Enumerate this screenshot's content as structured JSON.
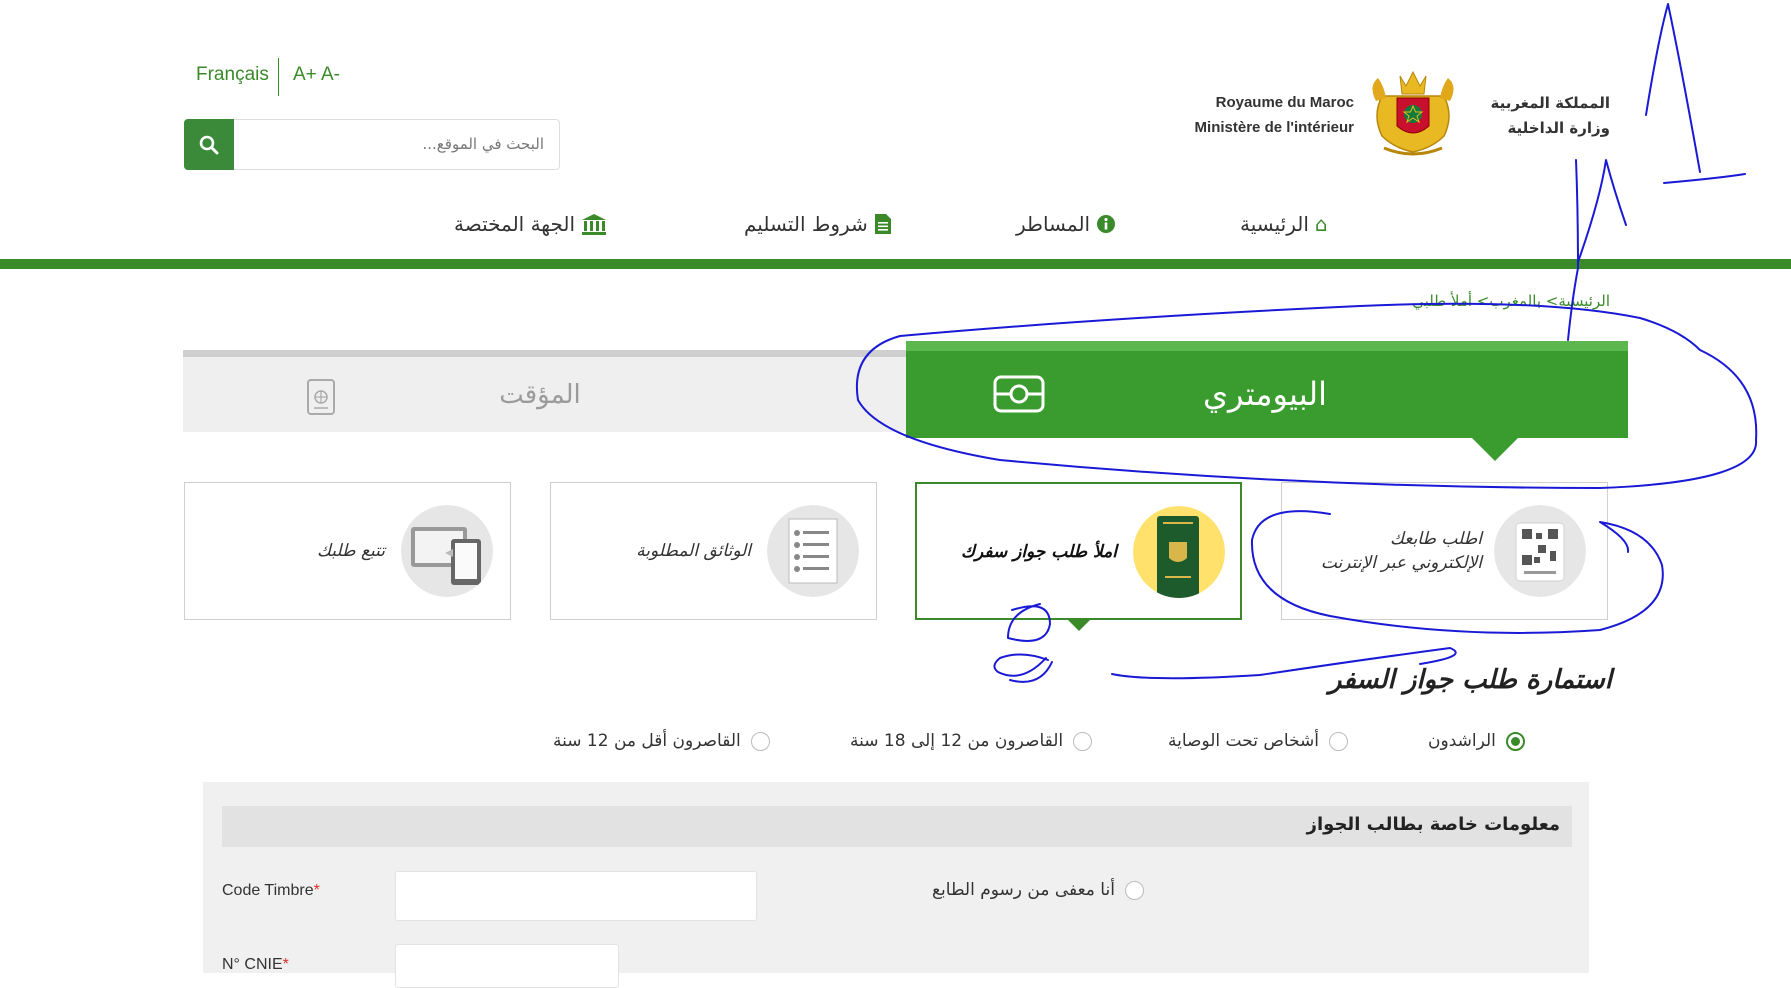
{
  "header": {
    "language_link": "Français",
    "font_size_controls": "A+ A-",
    "search_placeholder": "البحث في الموقع...",
    "ministry_fr_line1": "Royaume du Maroc",
    "ministry_fr_line2": "Ministère de l'intérieur",
    "ministry_ar_line1": "المملكة المغربية",
    "ministry_ar_line2": "وزارة الداخلية"
  },
  "nav": {
    "items": [
      {
        "label": "الرئيسية",
        "icon": "home-icon"
      },
      {
        "label": "المساطر",
        "icon": "info-circle-icon"
      },
      {
        "label": "شروط التسليم",
        "icon": "document-icon"
      },
      {
        "label": "الجهة المختصة",
        "icon": "institution-icon"
      }
    ]
  },
  "breadcrumb": "الرئيسية> بالمغرب> أملأ طلبي",
  "tabs": {
    "biometric": "البيومتري",
    "temporary": "المؤقت"
  },
  "cards": [
    {
      "label_line1": "اطلب طابعك",
      "label_line2": "الإلكتروني عبر الإنترنت",
      "icon": "qr-stamp-icon"
    },
    {
      "label_line1": "املأ طلب جواز سفرك",
      "label_line2": "",
      "icon": "passport-icon"
    },
    {
      "label_line1": "الوثائق المطلوبة",
      "label_line2": "",
      "icon": "documents-checklist-icon"
    },
    {
      "label_line1": "تتبع طلبك",
      "label_line2": "",
      "icon": "devices-icon"
    }
  ],
  "form": {
    "title": "استمارة طلب جواز السفر",
    "applicant_types": [
      {
        "label": "الراشدون",
        "checked": true
      },
      {
        "label": "أشخاص تحت الوصاية",
        "checked": false
      },
      {
        "label": "القاصرون من 12 إلى 18 سنة",
        "checked": false
      },
      {
        "label": "القاصرون أقل من 12 سنة",
        "checked": false
      }
    ],
    "section_title": "معلومات خاصة بطالب الجواز",
    "code_timbre_label": "Code Timbre",
    "cnie_label": "N° CNIE",
    "required_mark": "*",
    "exempt_label": "أنا معفى من رسوم الطابع"
  },
  "colors": {
    "brand_green": "#3a8a2a",
    "tab_green": "#3a9c2e",
    "annotation_blue": "#1a1ad6"
  }
}
